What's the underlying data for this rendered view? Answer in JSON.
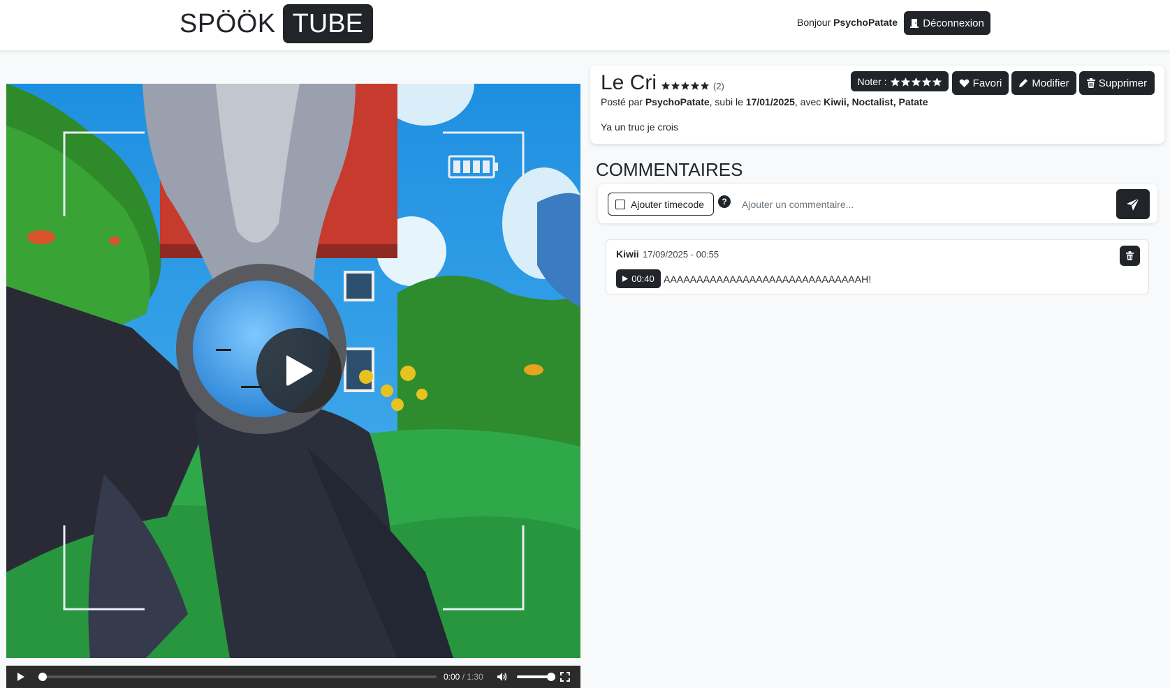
{
  "header": {
    "logo_part1": "SPÖÖK",
    "logo_part2": "TUBE",
    "greeting": "Bonjour",
    "username": "PsychoPatate",
    "logout_label": "Déconnexion"
  },
  "video": {
    "current_time": "0:00",
    "separator": "/",
    "duration": "1:30",
    "progress": 0,
    "volume": 1.0
  },
  "info": {
    "title": "Le Cri",
    "rating_count": "(2)",
    "rating_stars": 5,
    "posted_prefix": "Posté par",
    "author": "PsychoPatate",
    "date_prefix": ", subi le",
    "date": "17/01/2025",
    "with_prefix": ", avec",
    "participants": "Kiwii, Noctalist, Patate",
    "description": "Ya un truc je crois",
    "rate_label": "Noter :",
    "favorite_label": "Favori",
    "edit_label": "Modifier",
    "delete_label": "Supprimer"
  },
  "comments": {
    "heading": "COMMENTAIRES",
    "timecode_label": "Ajouter timecode",
    "help_label": "?",
    "input_placeholder": "Ajouter un commentaire...",
    "items": [
      {
        "author": "Kiwii",
        "date": "17/09/2025 - 00:55",
        "timecode": "00:40",
        "text": "AAAAAAAAAAAAAAAAAAAAAAAAAAAAAAH!"
      }
    ]
  },
  "colors": {
    "dark": "#212529",
    "background": "#f8f9fa"
  }
}
